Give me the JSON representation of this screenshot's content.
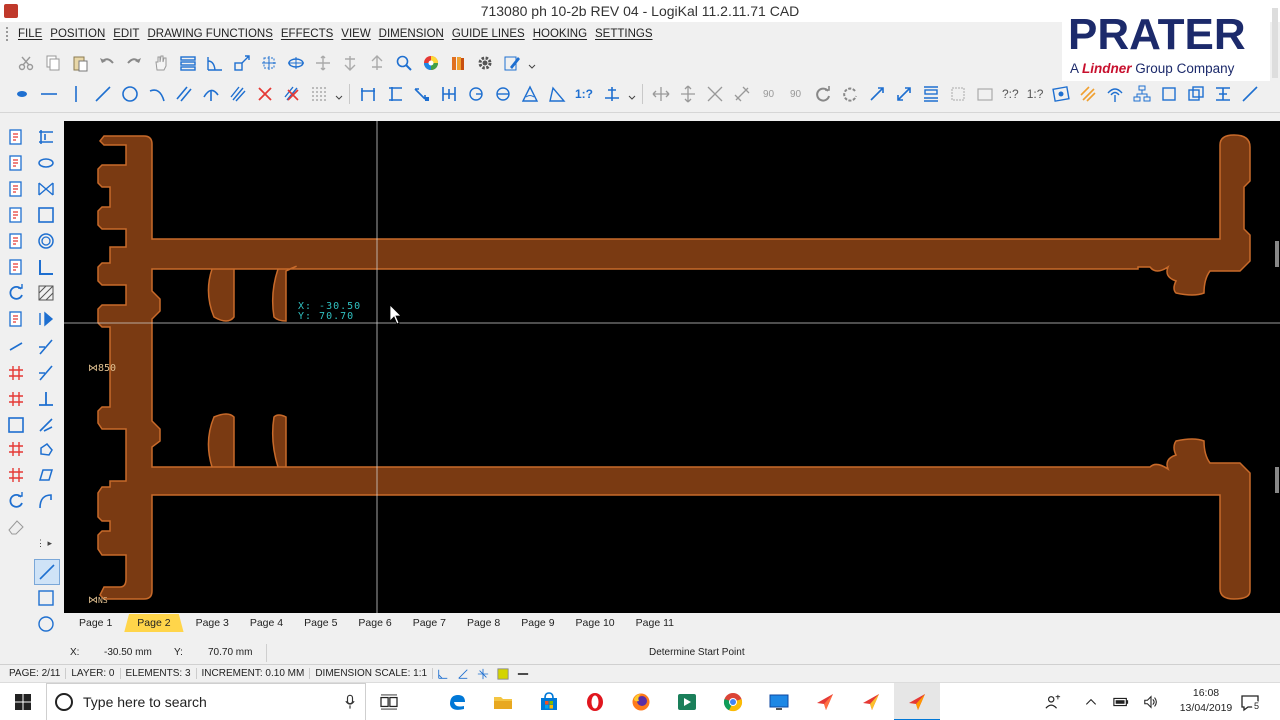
{
  "window": {
    "title": "713080 ph 10-2b REV 04 - LogiKal 11.2.11.71 CAD"
  },
  "menu": {
    "items": [
      "FILE",
      "POSITION",
      "EDIT",
      "DRAWING FUNCTIONS",
      "EFFECTS",
      "VIEW",
      "DIMENSION",
      "GUIDE LINES",
      "HOOKING",
      "SETTINGS"
    ]
  },
  "logo": {
    "main": "PRATER",
    "sub_prefix": "A",
    "sub_brand": "Lindner",
    "sub_suffix": "Group Company"
  },
  "toolbar2": {
    "scale_label_1": "1:?",
    "label_a": "?:?",
    "label_b": "1:?",
    "angle_a": "90",
    "angle_b": "90"
  },
  "canvas": {
    "cursor_readout_x": "X: -30.50",
    "cursor_readout_y": "Y: 70.70",
    "dim_label_height": "850",
    "dim_label_bottom": "NS"
  },
  "pages": {
    "tabs": [
      "Page 1",
      "Page 2",
      "Page 3",
      "Page 4",
      "Page 5",
      "Page 6",
      "Page 7",
      "Page 8",
      "Page 9",
      "Page 10",
      "Page 11"
    ],
    "active_index": 1
  },
  "coords": {
    "x_label": "X:",
    "x_value": "-30.50 mm",
    "y_label": "Y:",
    "y_value": "70.70 mm",
    "prompt": "Determine Start Point"
  },
  "status": {
    "page": "PAGE: 2/11",
    "layer": "LAYER: 0",
    "elements": "ELEMENTS: 3",
    "increment": "INCREMENT:  0.10 MM",
    "dimension_scale": "DIMENSION SCALE: 1:1"
  },
  "taskbar": {
    "search_placeholder": "Type here to search",
    "time": "16:08",
    "date": "13/04/2019",
    "notification_count": "5"
  },
  "colors": {
    "profile_fill": "#7a3a12",
    "profile_stroke": "#c86a2a",
    "canvas_bg": "#000000",
    "accent_blue": "#1e6fd0",
    "logo_navy": "#1c2a6b"
  }
}
